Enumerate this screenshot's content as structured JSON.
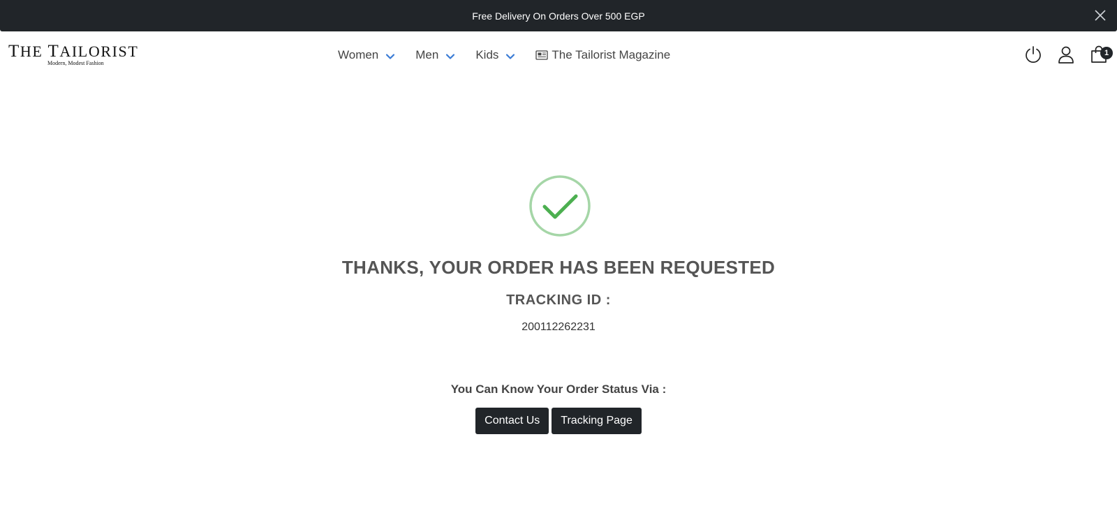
{
  "announcement": {
    "text": "Free Delivery On Orders Over 500 EGP",
    "close_icon": "close-icon"
  },
  "header": {
    "logo_first": "T",
    "logo_rest_1": "HE ",
    "logo_second": "T",
    "logo_rest_2": "AILORIST",
    "tagline": "Modern, Modest Fashion",
    "nav": [
      {
        "label": "Women",
        "icon": "chevron-down-icon"
      },
      {
        "label": "Men",
        "icon": "chevron-down-icon"
      },
      {
        "label": "Kids",
        "icon": "chevron-down-icon"
      },
      {
        "label": "The Tailorist Magazine",
        "icon": "newspaper-icon"
      }
    ],
    "icons": [
      "power-icon",
      "user-icon",
      "shopping-bag-icon"
    ],
    "cart_count": "1"
  },
  "confirmation": {
    "icon": "check-circle-icon",
    "title": "THANKS, YOUR ORDER HAS BEEN REQUESTED",
    "tracking_label": "TRACKING ID :",
    "tracking_id": "200112262231",
    "status_text": "You Can Know Your Order Status Via :",
    "contact_button": "Contact Us",
    "tracking_button": "Tracking Page"
  },
  "colors": {
    "dark": "#212529",
    "accent_blue": "#3a7bd5",
    "success_green": "#4caf50",
    "success_green_light": "#a5d6a7"
  }
}
